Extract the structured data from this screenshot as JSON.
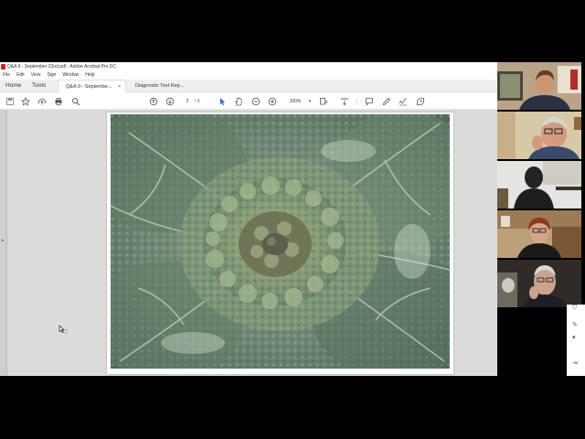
{
  "window": {
    "title": "Q&A 9 - September 22nd.pdf - Adobe Acrobat Pro DC"
  },
  "menu": [
    "File",
    "Edit",
    "View",
    "Sign",
    "Window",
    "Help"
  ],
  "nav": {
    "home": "Home",
    "tools": "Tools"
  },
  "tabs": [
    {
      "label": "Q&A 9 - Septembe...",
      "close": "×",
      "active": true
    },
    {
      "label": "Diagnostic Test Rep...",
      "active": false
    }
  ],
  "toolbar": {
    "page_current": "2",
    "page_total": "/ 9",
    "zoom": "100%",
    "icons": [
      "save-icon",
      "bookmark-star-icon",
      "upload-icon",
      "print-icon",
      "search-icon",
      "page-up-icon",
      "page-down-icon",
      "select-arrow-icon",
      "hand-icon",
      "zoom-out-icon",
      "zoom-in-icon",
      "fit-page-icon",
      "scroll-icon",
      "comment-icon",
      "pen-icon",
      "sign-icon",
      "stamp-icon"
    ]
  },
  "document": {
    "image": "savoy-cabbage-photo"
  },
  "gallery": {
    "participants": [
      "participant-1",
      "participant-2",
      "participant-3",
      "participant-4",
      "participant-5"
    ]
  },
  "colors": {
    "acrobat_red": "#d12020",
    "doc_background": "#dcdcdc",
    "cabbage_green": "#6f8b76"
  }
}
